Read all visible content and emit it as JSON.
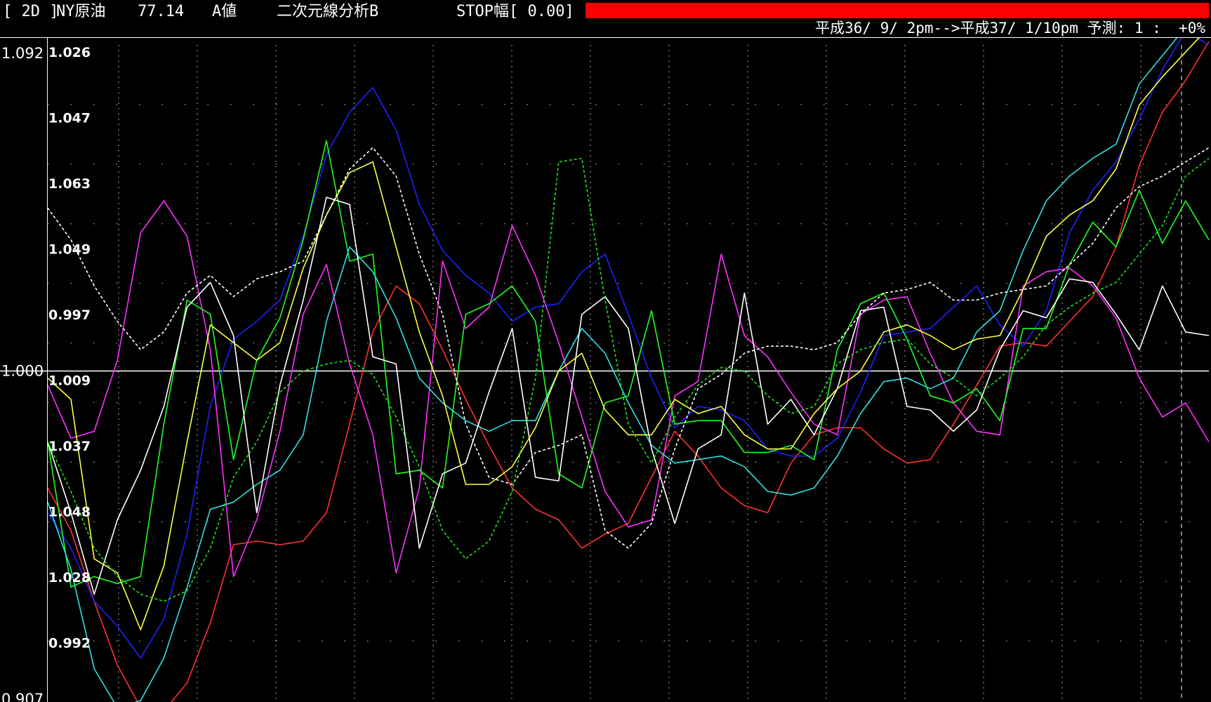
{
  "header": {
    "bracket": "[ 2D ]",
    "symbol": "NY原油",
    "price": "77.14",
    "mode": "A値",
    "analysis": "二次元線分析B",
    "stop": "STOP幅[ 0.00]",
    "date_range": "平成36/ 9/ 2pm-->平成37/ 1/10pm 予測: 1 :  +0%",
    "bar_color": "#ff0000"
  },
  "chart_data": {
    "type": "line",
    "title": "",
    "xlabel": "",
    "ylabel": "",
    "ylim": [
      0.907,
      1.092
    ],
    "grid": true,
    "baseline": 1.0,
    "y_ticks_outer": [
      "1.092",
      "1.000",
      "0.907"
    ],
    "y_ticks_inner": [
      "1.026",
      "1.047",
      "1.063",
      "1.049",
      "0.997",
      "1.009",
      "1.037",
      "1.048",
      "1.028",
      "0.992"
    ],
    "x": [
      0,
      1,
      2,
      3,
      4,
      5,
      6,
      7,
      8,
      9,
      10,
      11,
      12,
      13,
      14,
      15,
      16,
      17,
      18,
      19,
      20,
      21,
      22,
      23,
      24,
      25,
      26,
      27,
      28,
      29,
      30,
      31,
      32,
      33,
      34,
      35,
      36,
      37,
      38,
      39,
      40,
      41,
      42,
      43,
      44,
      45,
      46,
      47,
      48,
      49,
      50
    ],
    "series": [
      {
        "color": "#ff3030",
        "dashed": false,
        "values": [
          0.967,
          0.955,
          0.935,
          0.917,
          0.905,
          0.904,
          0.912,
          0.929,
          0.951,
          0.952,
          0.951,
          0.952,
          0.96,
          0.985,
          1.011,
          1.024,
          1.019,
          1.006,
          0.992,
          0.979,
          0.967,
          0.961,
          0.958,
          0.95,
          0.954,
          0.957,
          0.97,
          0.983,
          0.976,
          0.967,
          0.962,
          0.96,
          0.974,
          0.982,
          0.984,
          0.984,
          0.978,
          0.974,
          0.975,
          0.985,
          0.996,
          1.007,
          1.008,
          1.007,
          1.014,
          1.021,
          1.035,
          1.058,
          1.073,
          1.082,
          1.093
        ]
      },
      {
        "color": "#2020ff",
        "dashed": false,
        "values": [
          0.96,
          0.95,
          0.935,
          0.928,
          0.919,
          0.93,
          0.954,
          0.99,
          1.009,
          1.014,
          1.02,
          1.038,
          1.061,
          1.073,
          1.08,
          1.068,
          1.047,
          1.034,
          1.027,
          1.022,
          1.014,
          1.018,
          1.019,
          1.028,
          1.033,
          1.016,
          0.998,
          0.984,
          0.99,
          0.989,
          0.986,
          0.978,
          0.976,
          0.976,
          0.981,
          0.994,
          1.01,
          1.011,
          1.012,
          1.018,
          1.024,
          1.013,
          1.007,
          1.017,
          1.039,
          1.051,
          1.059,
          1.071,
          1.085,
          1.096,
          1.092
        ]
      },
      {
        "color": "#ff30ff",
        "dashed": false,
        "values": [
          0.996,
          0.981,
          0.983,
          1.003,
          1.039,
          1.048,
          1.038,
          1.006,
          0.942,
          0.958,
          0.983,
          1.016,
          1.03,
          1.002,
          0.982,
          0.943,
          0.967,
          1.031,
          1.012,
          1.018,
          1.041,
          1.027,
          1.008,
          0.987,
          0.966,
          0.956,
          0.958,
          0.993,
          0.997,
          1.033,
          1.01,
          1.004,
          0.994,
          0.985,
          0.982,
          1.016,
          1.02,
          1.021,
          1.005,
          0.991,
          0.983,
          0.982,
          1.024,
          1.028,
          1.029,
          1.024,
          1.015,
          0.998,
          0.987,
          0.991,
          0.98
        ]
      },
      {
        "color": "#20ff20",
        "dashed": false,
        "values": [
          0.98,
          0.939,
          0.942,
          0.94,
          0.942,
          0.985,
          1.02,
          1.016,
          0.975,
          1.003,
          1.015,
          1.037,
          1.065,
          1.031,
          1.033,
          0.971,
          0.972,
          0.967,
          1.016,
          1.019,
          1.024,
          1.014,
          0.971,
          0.967,
          0.991,
          0.993,
          1.017,
          0.985,
          0.986,
          0.986,
          0.977,
          0.977,
          0.979,
          0.975,
          1.006,
          1.019,
          1.022,
          1.009,
          0.993,
          0.991,
          0.995,
          0.986,
          1.012,
          1.012,
          1.03,
          1.042,
          1.035,
          1.051,
          1.036,
          1.048,
          1.037
        ]
      },
      {
        "color": "#30e0e0",
        "dashed": false,
        "values": [
          0.963,
          0.944,
          0.916,
          0.905,
          0.907,
          0.919,
          0.939,
          0.961,
          0.963,
          0.968,
          0.972,
          0.982,
          1.014,
          1.035,
          1.028,
          1.015,
          0.998,
          0.991,
          0.986,
          0.983,
          0.986,
          0.986,
          1.0,
          1.012,
          1.005,
          0.991,
          0.979,
          0.974,
          0.975,
          0.976,
          0.973,
          0.966,
          0.965,
          0.967,
          0.976,
          0.988,
          0.997,
          0.998,
          0.995,
          0.998,
          1.011,
          1.017,
          1.034,
          1.048,
          1.055,
          1.06,
          1.064,
          1.081,
          1.089,
          1.097,
          1.1
        ]
      },
      {
        "color": "#ffffff",
        "dashed": false,
        "values": [
          0.98,
          0.96,
          0.937,
          0.958,
          0.972,
          0.99,
          1.018,
          1.025,
          1.01,
          0.96,
          0.996,
          1.02,
          1.049,
          1.047,
          1.004,
          1.002,
          0.95,
          0.971,
          0.974,
          0.994,
          1.012,
          0.97,
          0.969,
          1.016,
          1.021,
          1.012,
          0.978,
          0.957,
          0.978,
          0.982,
          1.022,
          0.985,
          0.992,
          0.982,
          0.995,
          1.017,
          1.018,
          0.99,
          0.989,
          0.983,
          0.989,
          1.006,
          1.017,
          1.015,
          1.026,
          1.025,
          1.016,
          1.006,
          1.024,
          1.011,
          1.01
        ]
      },
      {
        "color": "#ffff40",
        "dashed": false,
        "values": [
          0.998,
          0.992,
          0.947,
          0.943,
          0.927,
          0.945,
          0.98,
          1.013,
          1.008,
          1.003,
          1.008,
          1.029,
          1.044,
          1.056,
          1.059,
          1.035,
          1.011,
          0.993,
          0.968,
          0.968,
          0.973,
          0.984,
          1.0,
          1.005,
          0.989,
          0.982,
          0.982,
          0.992,
          0.988,
          0.99,
          0.982,
          0.978,
          0.978,
          0.988,
          0.995,
          1.0,
          1.011,
          1.013,
          1.01,
          1.006,
          1.009,
          1.01,
          1.023,
          1.038,
          1.044,
          1.048,
          1.057,
          1.075,
          1.083,
          1.09,
          1.097
        ]
      },
      {
        "color": "#ffffff",
        "dashed": true,
        "values": [
          1.046,
          1.037,
          1.024,
          1.014,
          1.006,
          1.011,
          1.022,
          1.027,
          1.021,
          1.026,
          1.028,
          1.031,
          1.044,
          1.057,
          1.063,
          1.055,
          1.033,
          1.016,
          0.985,
          0.97,
          0.968,
          0.977,
          0.979,
          0.982,
          0.955,
          0.95,
          0.957,
          0.978,
          0.995,
          0.999,
          1.005,
          1.007,
          1.007,
          1.006,
          1.008,
          1.016,
          1.022,
          1.023,
          1.025,
          1.02,
          1.02,
          1.022,
          1.023,
          1.024,
          1.03,
          1.036,
          1.046,
          1.052,
          1.055,
          1.059,
          1.063
        ]
      },
      {
        "color": "#20e020",
        "dashed": true,
        "values": [
          0.98,
          0.966,
          0.95,
          0.942,
          0.937,
          0.935,
          0.938,
          0.95,
          0.97,
          0.98,
          0.994,
          1.0,
          1.002,
          1.003,
          0.999,
          0.987,
          0.973,
          0.955,
          0.947,
          0.952,
          0.966,
          0.998,
          1.059,
          1.06,
          1.02,
          0.985,
          0.974,
          0.987,
          0.996,
          1.001,
          1.0,
          0.993,
          0.988,
          0.99,
          1.002,
          1.006,
          1.008,
          1.009,
          1.002,
          0.998,
          0.993,
          0.998,
          1.004,
          1.013,
          1.018,
          1.022,
          1.025,
          1.033,
          1.041,
          1.055,
          1.06
        ]
      }
    ]
  }
}
